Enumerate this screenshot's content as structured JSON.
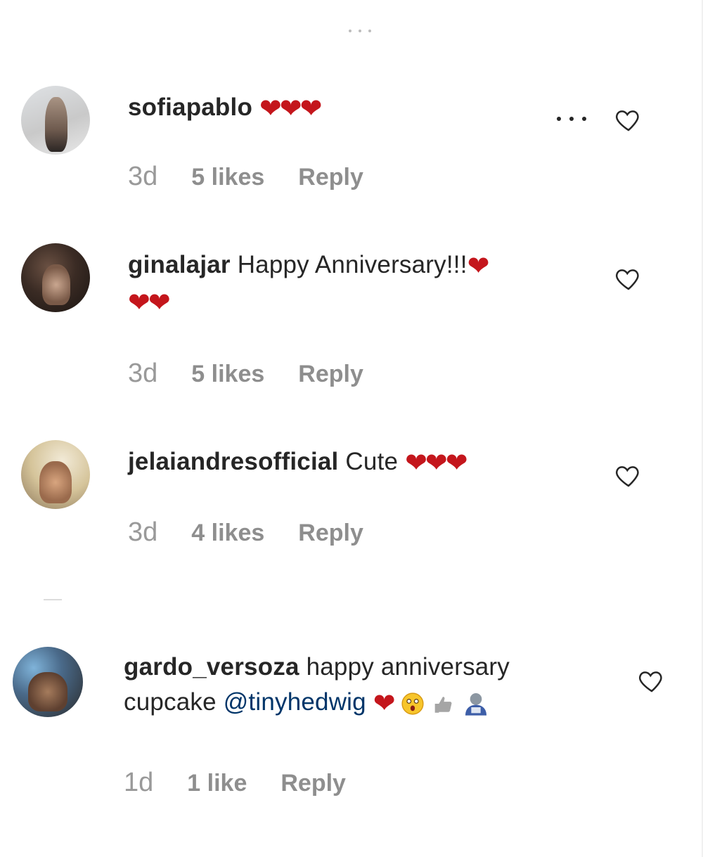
{
  "comments": [
    {
      "username": "sofiapablo",
      "text": "",
      "hearts": "❤❤❤",
      "time": "3d",
      "likes": "5 likes",
      "reply": "Reply"
    },
    {
      "username": "ginalajar",
      "text": "Happy Anniversary!!!",
      "hearts_line1": "❤",
      "hearts_line2": "❤❤",
      "time": "3d",
      "likes": "5 likes",
      "reply": "Reply"
    },
    {
      "username": "jelaiandresofficial",
      "text": "Cute",
      "hearts": "❤❤❤",
      "time": "3d",
      "likes": "4 likes",
      "reply": "Reply"
    },
    {
      "username": "gardo_versoza",
      "text_line1": "happy anniversary",
      "text_line2": "cupcake",
      "mention": "@tinyhedwig",
      "hearts": "❤",
      "time": "1d",
      "likes": "1 like",
      "reply": "Reply"
    }
  ],
  "icons": {
    "like": "heart-outline-icon",
    "more": "more-options-icon"
  }
}
